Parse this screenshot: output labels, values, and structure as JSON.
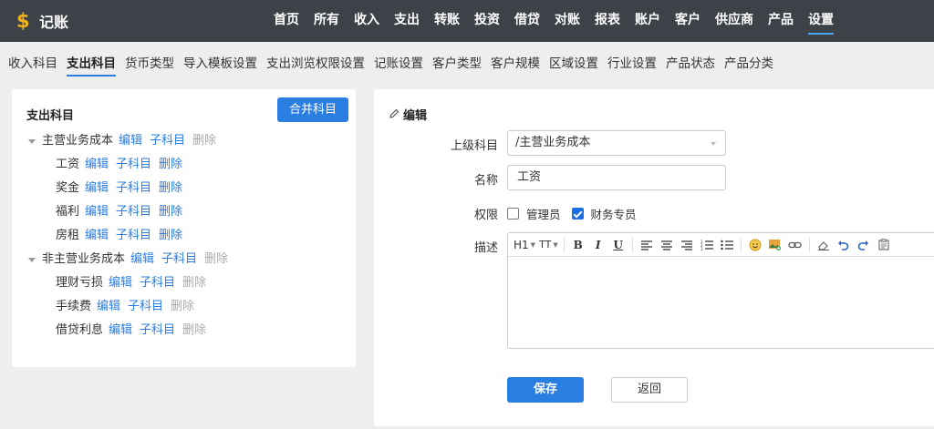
{
  "app": {
    "logo_icon": "$",
    "title": "记账"
  },
  "nav": [
    {
      "label": "首页"
    },
    {
      "label": "所有"
    },
    {
      "label": "收入"
    },
    {
      "label": "支出"
    },
    {
      "label": "转账"
    },
    {
      "label": "投资"
    },
    {
      "label": "借贷"
    },
    {
      "label": "对账"
    },
    {
      "label": "报表"
    },
    {
      "label": "账户"
    },
    {
      "label": "客户"
    },
    {
      "label": "供应商"
    },
    {
      "label": "产品"
    },
    {
      "label": "设置",
      "active": true
    }
  ],
  "subnav": [
    {
      "label": "收入科目"
    },
    {
      "label": "支出科目",
      "active": true
    },
    {
      "label": "货币类型"
    },
    {
      "label": "导入模板设置"
    },
    {
      "label": "支出浏览权限设置"
    },
    {
      "label": "记账设置"
    },
    {
      "label": "客户类型"
    },
    {
      "label": "客户规模"
    },
    {
      "label": "区域设置"
    },
    {
      "label": "行业设置"
    },
    {
      "label": "产品状态"
    },
    {
      "label": "产品分类"
    }
  ],
  "left": {
    "title": "支出科目",
    "merge_button": "合并科目",
    "edit_label": "编辑",
    "sub_label": "子科目",
    "delete_label": "删除",
    "tree": [
      {
        "name": "主营业务成本",
        "children": [
          "工资",
          "奖金",
          "福利",
          "房租"
        ]
      },
      {
        "name": "非主营业务成本",
        "children": [
          "理财亏损",
          "手续费",
          "借贷利息"
        ]
      }
    ]
  },
  "right": {
    "title": "编辑",
    "parent_label": "上级科目",
    "parent_value": "/主营业务成本",
    "name_label": "名称",
    "name_value": "工资",
    "perm_label": "权限",
    "perm_admin": "管理员",
    "perm_finance": "财务专员",
    "perm_admin_checked": false,
    "perm_finance_checked": true,
    "desc_label": "描述",
    "toolbar": {
      "h1": "H1",
      "font": "TT",
      "bold": "B",
      "italic": "I",
      "underline": "U"
    },
    "save_button": "保存",
    "back_button": "返回"
  },
  "colors": {
    "accent": "#2a7de1",
    "nav_bg": "#3d4148",
    "logo": "#f3b21b"
  }
}
